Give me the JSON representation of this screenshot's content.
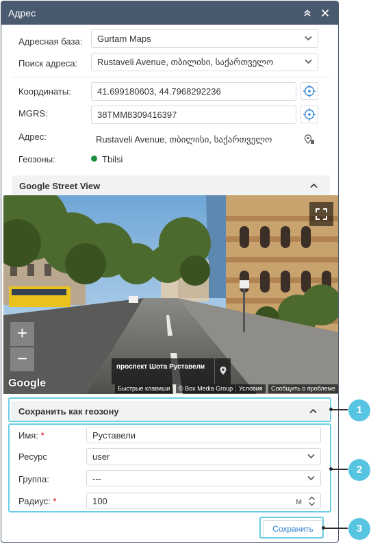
{
  "window": {
    "title": "Адрес"
  },
  "address_base": {
    "label": "Адресная база:",
    "value": "Gurtam Maps"
  },
  "address_search": {
    "label": "Поиск адреса:",
    "value": "Rustaveli Avenue, თბილისი, საქართველო"
  },
  "coordinates": {
    "label": "Координаты:",
    "value": "41.699180603, 44.7968292236"
  },
  "mgrs": {
    "label": "MGRS:",
    "value": "38TMM8309416397"
  },
  "address": {
    "label": "Адрес:",
    "value": "Rustaveli Avenue, თბილისი, საქართველო"
  },
  "geozones": {
    "label": "Геозоны:",
    "value": "Tbilsi",
    "dot_color": "#1e8e3e"
  },
  "street_view": {
    "header": "Google Street View",
    "place_name": "проспект Шота Руставели",
    "google": "Google",
    "attr": [
      "Быстрые клавиши",
      "© Box Media Group",
      "Условия",
      "Сообщить о проблеме"
    ],
    "zoom_in": "+",
    "zoom_out": "−"
  },
  "geozone_form": {
    "header": "Сохранить как геозону",
    "name": {
      "label": "Имя:",
      "required": "*",
      "value": "Руставели"
    },
    "resource": {
      "label": "Ресурс",
      "value": "user"
    },
    "group": {
      "label": "Группа:",
      "value": "---"
    },
    "radius": {
      "label": "Радиус:",
      "required": "*",
      "value": "100",
      "unit": "м"
    },
    "save": "Сохранить"
  },
  "callouts": [
    "1",
    "2",
    "3"
  ],
  "colors": {
    "titlebar": "#4a5a6e",
    "accent": "#2f82d6",
    "callout": "#57c4e2"
  }
}
